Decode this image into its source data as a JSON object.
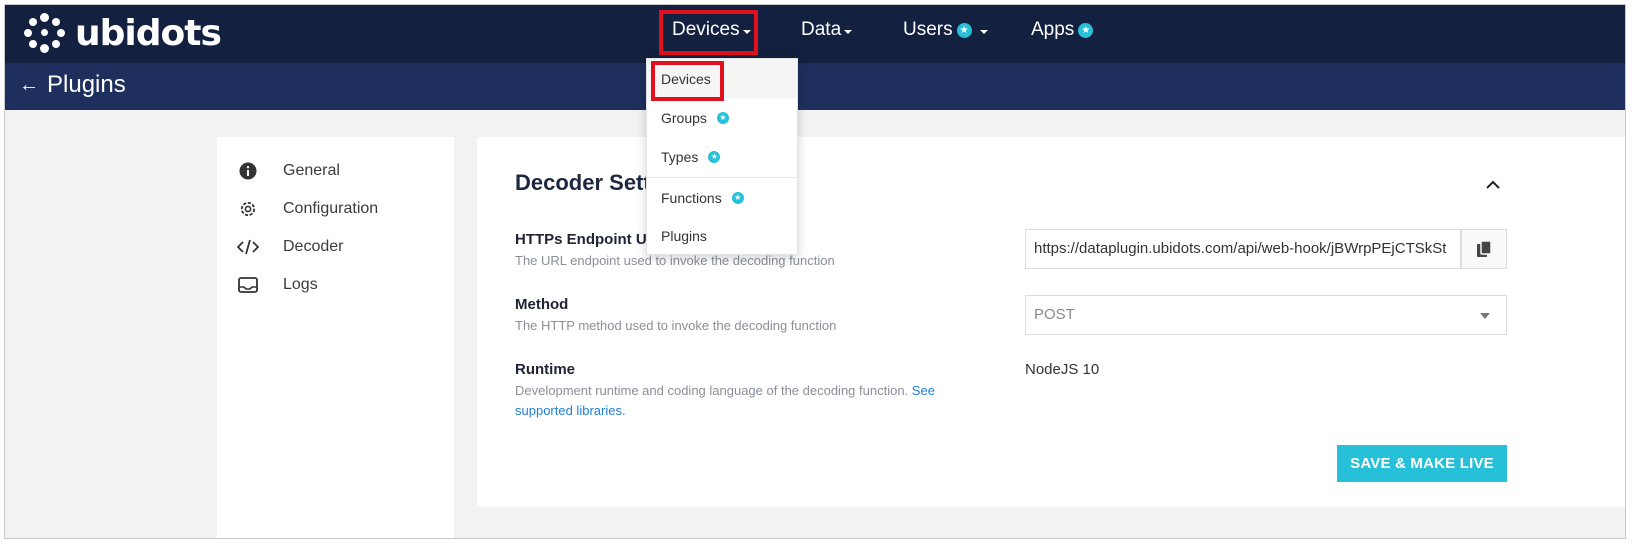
{
  "brand": {
    "name": "ubidots"
  },
  "nav": {
    "devices": "Devices",
    "data": "Data",
    "users": "Users",
    "apps": "Apps"
  },
  "page": {
    "title": "Plugins"
  },
  "dropdown": {
    "items": [
      {
        "label": "Devices",
        "badge": false
      },
      {
        "label": "Groups",
        "badge": true
      },
      {
        "label": "Types",
        "badge": true
      },
      {
        "label": "Functions",
        "badge": true
      },
      {
        "label": "Plugins",
        "badge": false
      }
    ]
  },
  "sidebar": {
    "items": [
      {
        "label": "General",
        "icon": "info-icon"
      },
      {
        "label": "Configuration",
        "icon": "gear-icon"
      },
      {
        "label": "Decoder",
        "icon": "code-icon"
      },
      {
        "label": "Logs",
        "icon": "inbox-icon"
      }
    ]
  },
  "decoder": {
    "title": "Decoder Settings",
    "endpoint": {
      "label": "HTTPs Endpoint URL",
      "help": "The URL endpoint used to invoke the decoding function",
      "value": "https://dataplugin.ubidots.com/api/web-hook/jBWrpPEjCTSkSt"
    },
    "method": {
      "label": "Method",
      "help": "The HTTP method used to invoke the decoding function",
      "value": "POST"
    },
    "runtime": {
      "label": "Runtime",
      "help": "Development runtime and coding language of the decoding function.",
      "link": "See supported libraries.",
      "value": "NodeJS 10"
    },
    "save_label": "SAVE & MAKE LIVE"
  },
  "colors": {
    "topbar": "#13203f",
    "subbar": "#1e2f5d",
    "accent": "#26c1d8",
    "highlight": "#e0101c"
  }
}
